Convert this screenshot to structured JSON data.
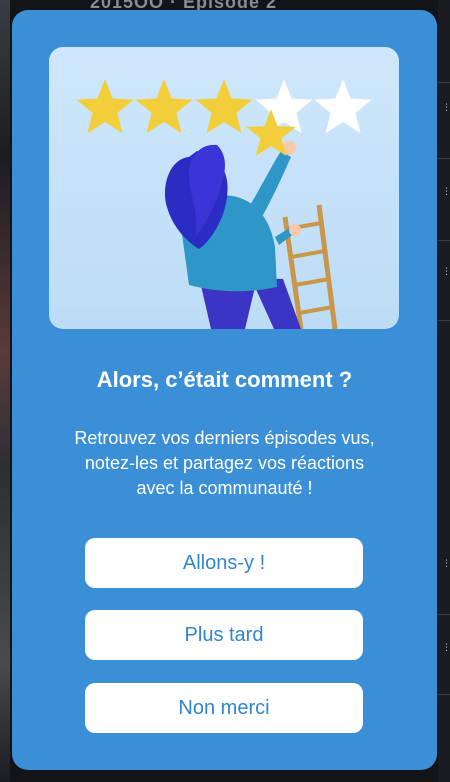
{
  "modal": {
    "title": "Alors, c’était comment ?",
    "message_lines": [
      "Retrouvez vos derniers épisodes vus,",
      "notez-les et partagez vos réactions",
      "avec la communauté !"
    ],
    "buttons": {
      "primary_label": "Allons-y !",
      "later_label": "Plus tard",
      "decline_label": "Non merci"
    },
    "illustration": {
      "stars_total": 5,
      "stars_filled": 3,
      "star_color": "#f2cf3a",
      "empty_star_color": "#ffffff"
    }
  },
  "colors": {
    "modal_background": "#3a8fd6",
    "button_text": "#2f86d1",
    "button_background": "#ffffff"
  },
  "background": {
    "partial_text": "2015OO · Episode 2"
  }
}
